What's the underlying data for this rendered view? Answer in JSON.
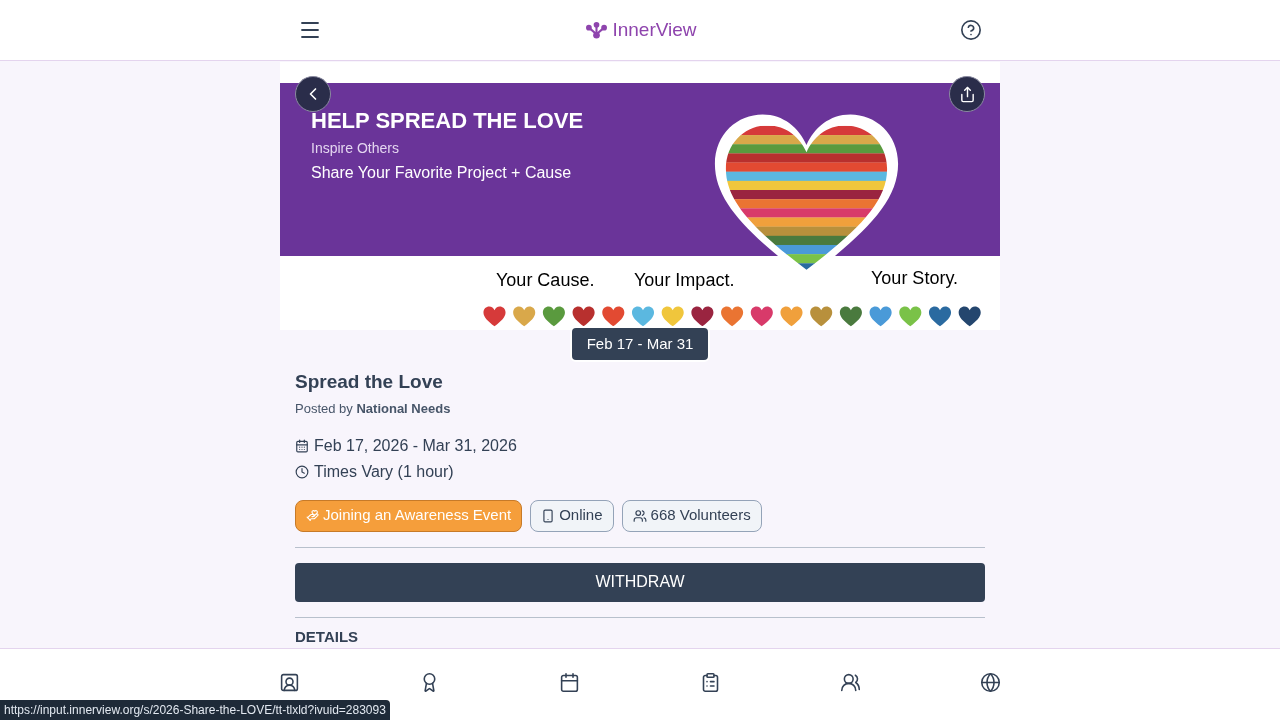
{
  "header": {
    "logo_text": "InnerView"
  },
  "banner": {
    "headline": "HELP SPREAD THE LOVE",
    "subtitle": "Inspire Others",
    "tagline": "Share Your Favorite Project + Cause",
    "captions": [
      "Your Cause.",
      "Your Impact.",
      "Your Story."
    ]
  },
  "date_badge": "Feb 17 - Mar 31",
  "event": {
    "title": "Spread the Love",
    "posted_by_label": "Posted by",
    "posted_by": "National Needs",
    "dates": "Feb 17, 2026 - Mar 31, 2026",
    "times": "Times Vary (1 hour)"
  },
  "tags": [
    {
      "kind": "category",
      "label": "Joining an Awareness Event"
    },
    {
      "kind": "online",
      "label": "Online"
    },
    {
      "kind": "volunteers",
      "label": "668 Volunteers"
    }
  ],
  "action_button": "WITHDRAW",
  "section_heading": "DETAILS",
  "bottom_nav": [
    {
      "kind": "profile",
      "selected": false
    },
    {
      "kind": "badges",
      "selected": false
    },
    {
      "kind": "calendar",
      "selected": false
    },
    {
      "kind": "tasks",
      "selected": false
    },
    {
      "kind": "groups",
      "selected": false
    },
    {
      "kind": "explore",
      "selected": false
    }
  ],
  "status_url": "https://input.innerview.org/s/2026-Share-the-LOVE/tt-tlxld?ivuid=283093"
}
